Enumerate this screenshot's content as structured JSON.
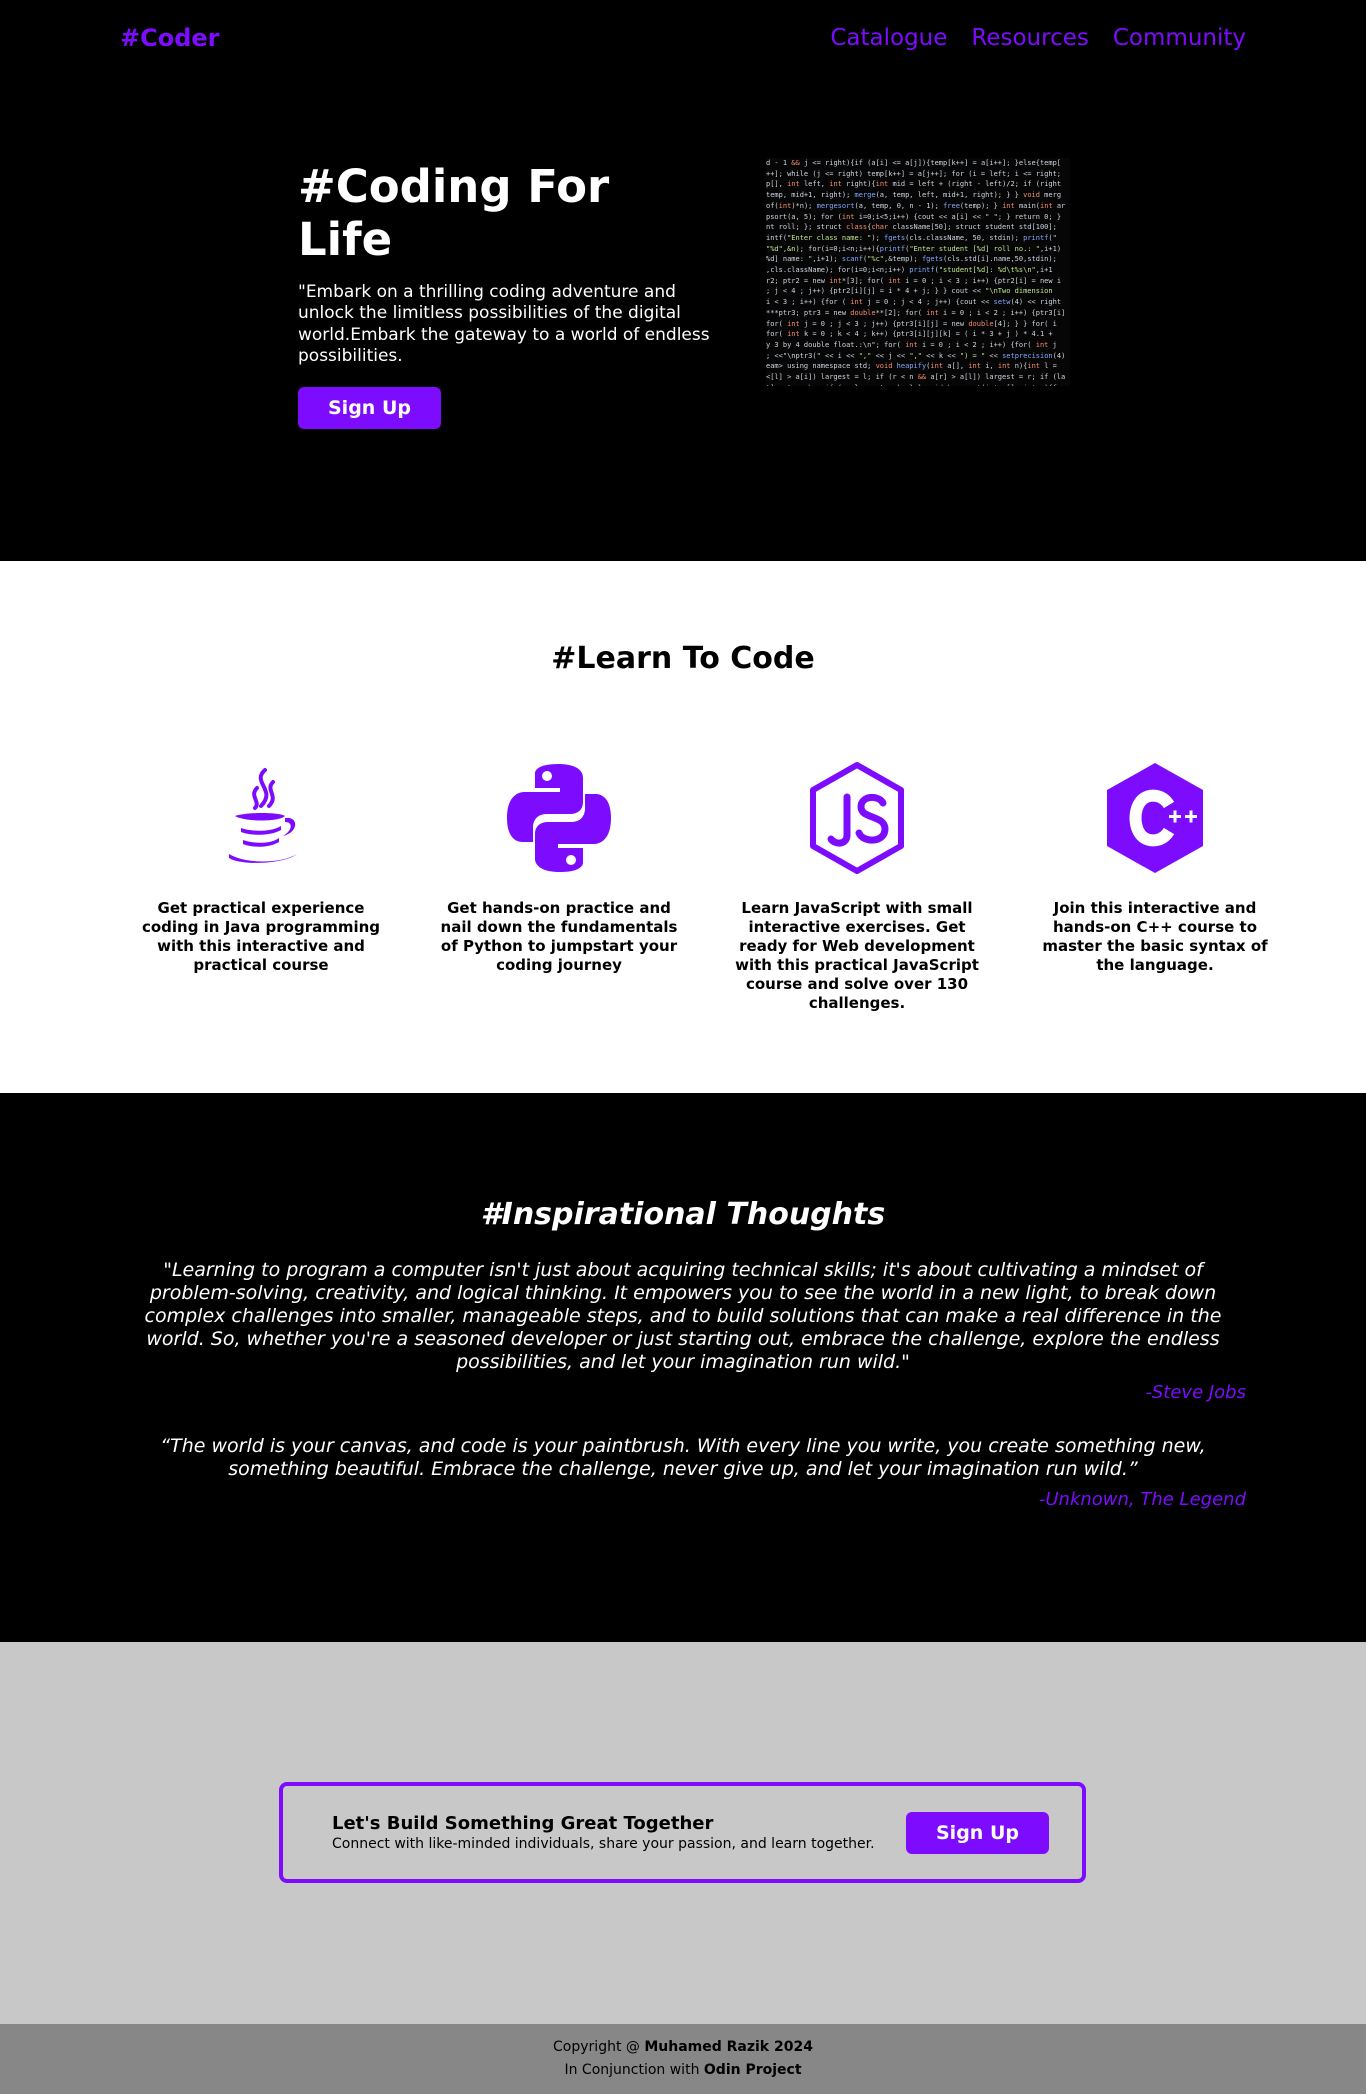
{
  "nav": {
    "brand": "#Coder",
    "links": [
      "Catalogue",
      "Resources",
      "Community"
    ]
  },
  "hero": {
    "title": "#Coding For Life",
    "text": "\"Embark on a thrilling coding adventure and unlock the limitless possibilities of the digital world.Embark the gateway to a world of endless possibilities.",
    "signup_label": "Sign Up"
  },
  "learn": {
    "title": "#Learn To Code",
    "cards": [
      {
        "icon": "java-icon",
        "text": "Get practical experience coding in Java programming with this interactive and practical course"
      },
      {
        "icon": "python-icon",
        "text": "Get hands-on practice and nail down the fundamentals of Python to jumpstart your coding journey"
      },
      {
        "icon": "javascript-icon",
        "text": "Learn JavaScript with small interactive exercises. Get ready for Web development with this practical JavaScript course and solve over 130 challenges."
      },
      {
        "icon": "cpp-icon",
        "text": "Join this interactive and hands-on C++ course to master the basic syntax of the language."
      }
    ]
  },
  "quotes": {
    "title": "#Inspirational Thoughts",
    "items": [
      {
        "text": "\"Learning to program a computer isn't just about acquiring technical skills; it's about cultivating a mindset of problem-solving, creativity, and logical thinking. It empowers you to see the world in a new light, to break down complex challenges into smaller, manageable steps, and to build solutions that can make a real difference in the world. So, whether you're a seasoned developer or just starting out, embrace the challenge, explore the endless possibilities, and let your imagination run wild.\"",
        "author": "-Steve Jobs"
      },
      {
        "text": "“The world is your canvas, and code is your paintbrush. With every line you write, you create something new, something beautiful. Embrace the challenge, never give up, and let your imagination run wild.”",
        "author": "-Unknown, The Legend"
      }
    ]
  },
  "cta": {
    "heading": "Let's Build Something Great Together",
    "sub": "Connect with like-minded individuals, share your passion, and learn together.",
    "signup_label": "Sign Up"
  },
  "footer": {
    "line1_prefix": "Copyright @ ",
    "line1_name": "Muhamed Razik 2024",
    "line2_prefix": "In Conjunction with ",
    "line2_name": "Odin Project"
  },
  "colors": {
    "accent": "#7d0cff",
    "hero_bg": "#000000",
    "cta_bg": "#c8c8c8",
    "footer_bg": "#878787"
  }
}
